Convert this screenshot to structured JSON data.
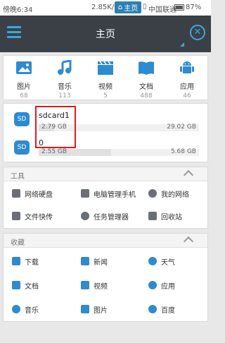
{
  "status": {
    "time": "傍晚6:34",
    "speed": "2.85K/s",
    "home_label": "主页",
    "carrier": "中国联通",
    "battery": "87%"
  },
  "header": {
    "title": "主页"
  },
  "categories": [
    {
      "label": "图片",
      "count": "68",
      "icon": "image-icon"
    },
    {
      "label": "音乐",
      "count": "113",
      "icon": "music-icon"
    },
    {
      "label": "视频",
      "count": "5",
      "icon": "video-icon"
    },
    {
      "label": "文档",
      "count": "488",
      "icon": "document-icon"
    },
    {
      "label": "应用",
      "count": "46",
      "icon": "android-icon"
    }
  ],
  "storage": {
    "sdcard1": {
      "badge": "SD",
      "name": "sdcard1",
      "used": "2.79 GB",
      "total": "29.02 GB",
      "used_fraction": 0.096
    },
    "sdcard0": {
      "badge": "SD",
      "name": "0",
      "used": "2.55 GB",
      "total": "5.68 GB",
      "used_fraction": 0.45
    }
  },
  "tools": {
    "title": "工具",
    "items": [
      {
        "label": "网络硬盘"
      },
      {
        "label": "电脑管理手机"
      },
      {
        "label": "我的网络"
      },
      {
        "label": "文件快传"
      },
      {
        "label": "任务管理器"
      },
      {
        "label": "回收站"
      }
    ]
  },
  "favorites": {
    "title": "收藏",
    "items": [
      {
        "label": "下载"
      },
      {
        "label": "新闻"
      },
      {
        "label": "天气"
      },
      {
        "label": "文档"
      },
      {
        "label": "视频"
      },
      {
        "label": "应用"
      },
      {
        "label": "音乐"
      },
      {
        "label": "图片"
      },
      {
        "label": "百度"
      }
    ]
  }
}
